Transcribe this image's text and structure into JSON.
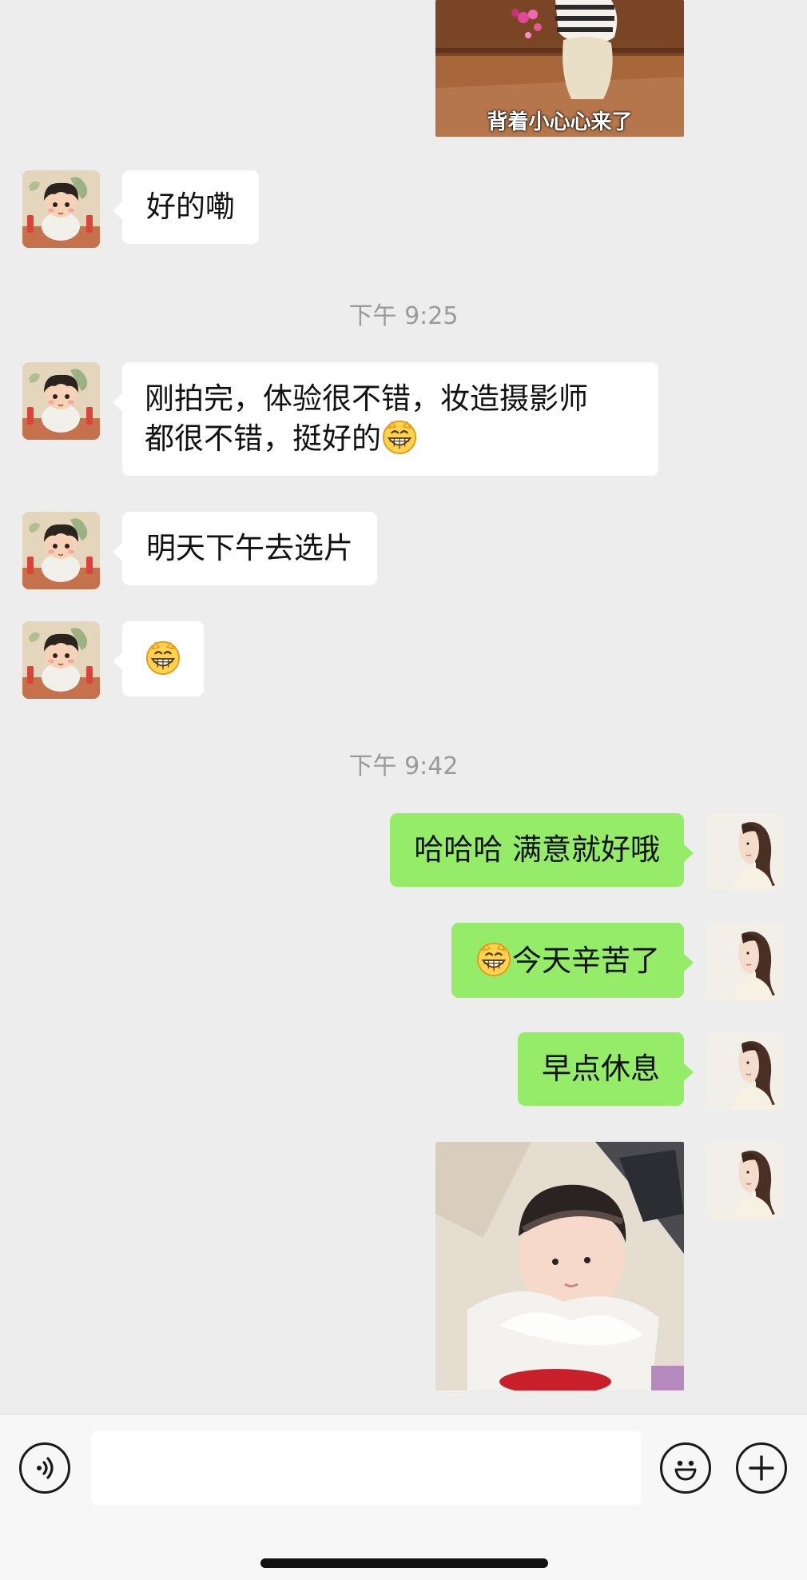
{
  "photo_caption": "背着小心心来了",
  "messages": {
    "m1": "好的嘞",
    "m2_line1": "刚拍完，体验很不错，妆造摄影师",
    "m2_line2": "都很不错，挺好的",
    "m3": "明天下午去选片",
    "m5": "哈哈哈 满意就好哦",
    "m6": "今天辛苦了",
    "m7": "早点休息"
  },
  "timestamps": {
    "t1": "下午 9:25",
    "t2": "下午 9:42"
  },
  "emoji": "grinning-face",
  "colors": {
    "background": "#ededed",
    "incoming_bubble": "#ffffff",
    "outgoing_bubble": "#95ec69",
    "timestamp_text": "#9a9a9a"
  },
  "input": {
    "value": "",
    "placeholder": ""
  },
  "icons": {
    "voice": "voice-icon",
    "emoji": "emoji-icon",
    "plus": "plus-icon"
  }
}
